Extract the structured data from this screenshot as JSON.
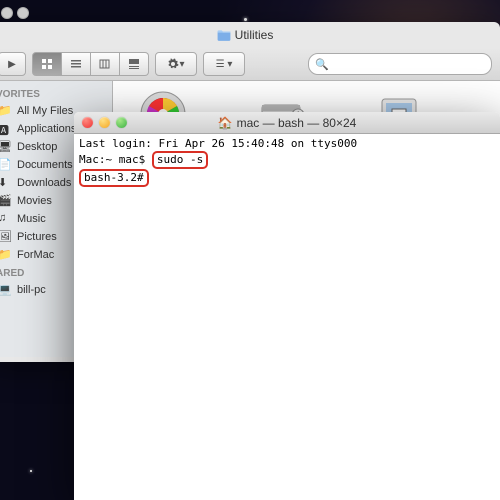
{
  "finder": {
    "title": "Utilities",
    "sidebar": {
      "section1": "VORITES",
      "section2": "ARED",
      "items": [
        "All My Files",
        "Applications",
        "Desktop",
        "Documents",
        "Downloads",
        "Movies",
        "Music",
        "Pictures",
        "ForMac"
      ],
      "shared": [
        "bill-pc"
      ]
    },
    "apps": {
      "a1": "DigitalColor Meter",
      "a2": "Disk Utility",
      "a3": "Grab"
    }
  },
  "terminal": {
    "title": "mac — bash — 80×24",
    "line1": "Last login: Fri Apr 26 15:40:48 on ttys000",
    "prompt1": "Mac:~ mac$",
    "cmd1": "sudo -s",
    "prompt2": "bash-3.2#"
  }
}
